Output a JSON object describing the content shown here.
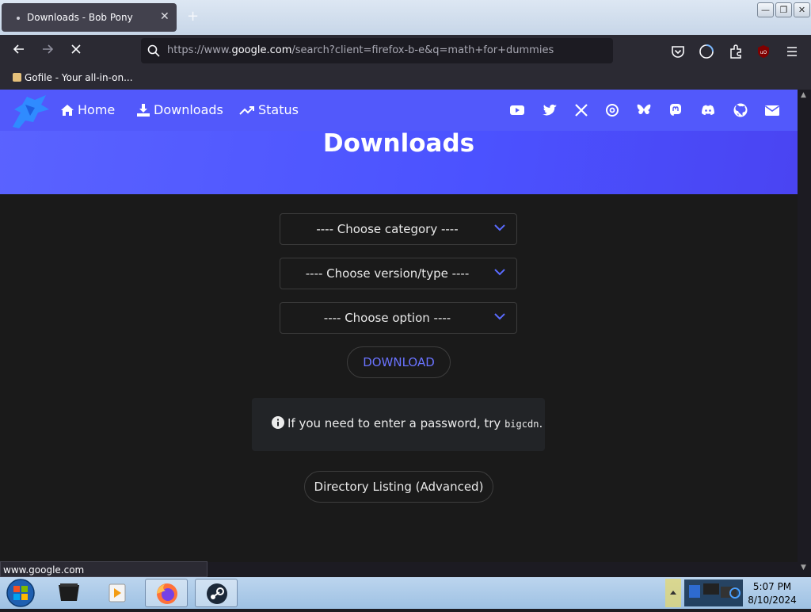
{
  "browser": {
    "tab_title": "Downloads - Bob Pony",
    "tab_close": "✕",
    "new_tab": "+",
    "url_prefix": "https://www.",
    "url_domain": "google.com",
    "url_path": "/search?client=firefox-b-e&q=math+for+dummies",
    "bookmark_label": "Gofile - Your all-in-on...",
    "status_url": "www.google.com",
    "window_controls": [
      "—",
      "❐",
      "✕"
    ],
    "icons": [
      "back-icon",
      "forward-icon",
      "stop-loading-icon",
      "search-icon",
      "pocket-icon",
      "account-icon",
      "extensions-icon",
      "ublock-icon",
      "menu-icon"
    ]
  },
  "site": {
    "nav": {
      "home": "Home",
      "downloads": "Downloads",
      "status": "Status"
    },
    "social_icons": [
      "youtube-icon",
      "twitter-icon",
      "x-icon",
      "threads-icon",
      "bluesky-icon",
      "mastodon-icon",
      "discord-icon",
      "github-icon",
      "email-icon"
    ],
    "hero_title": "Downloads",
    "accent_color": "#5259fb",
    "selects": {
      "category": "---- Choose category ----",
      "version": "---- Choose version/type ----",
      "option": "---- Choose option ----"
    },
    "download_button": "DOWNLOAD",
    "note_text": "If you need to enter a password, try",
    "note_code": "bigcdn",
    "note_end": ".",
    "directory_button": "Directory Listing (Advanced)"
  },
  "taskbar": {
    "time": "5:07 PM",
    "date": "8/10/2024",
    "apps": [
      "start-orb",
      "media-app",
      "video-player",
      "firefox",
      "steam"
    ]
  }
}
